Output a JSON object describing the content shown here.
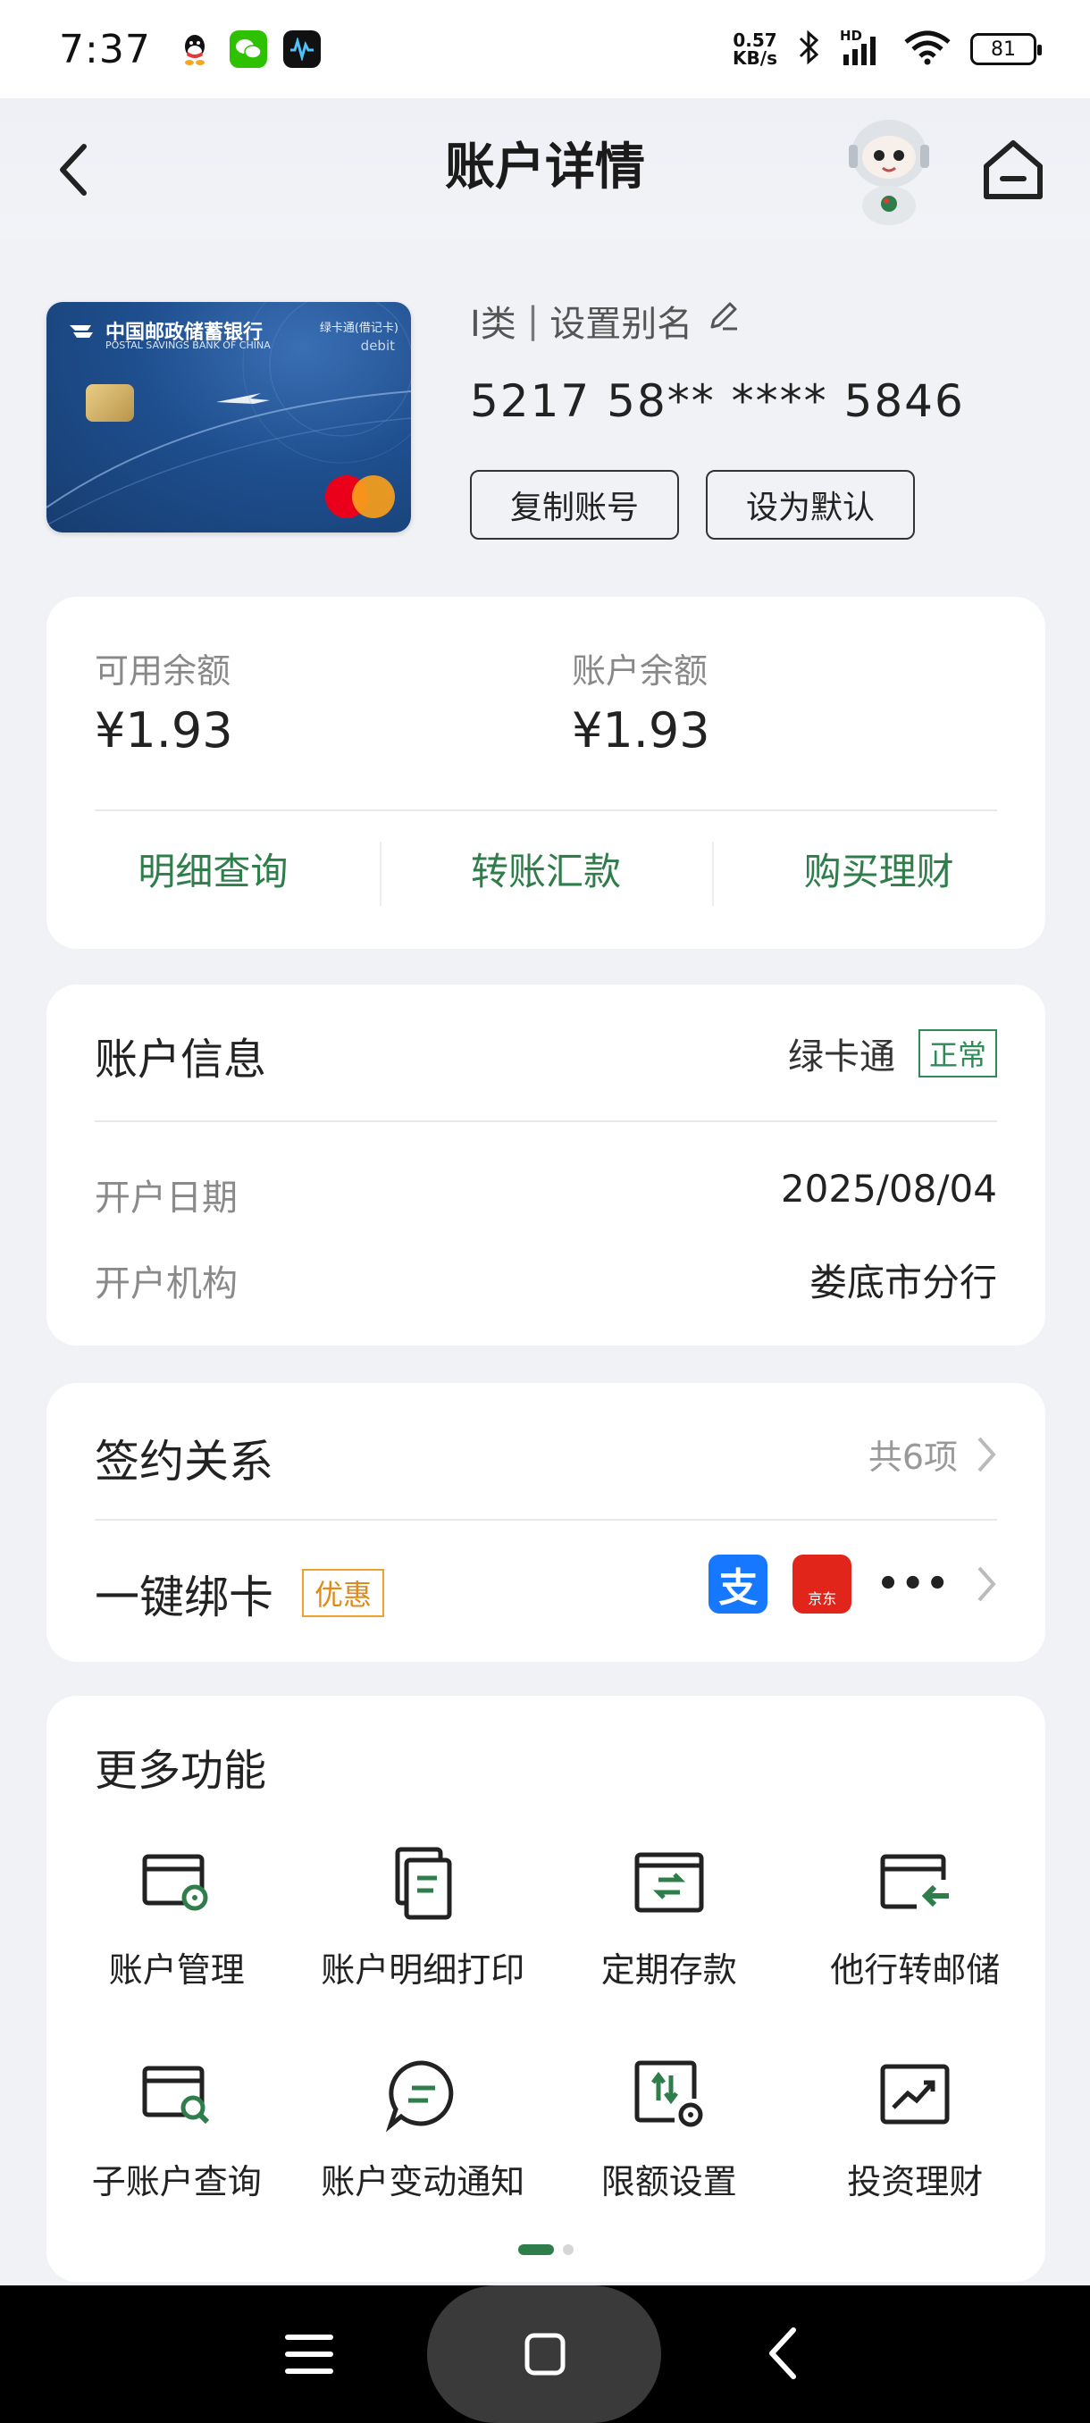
{
  "status_bar": {
    "time": "7:37",
    "net_speed_value": "0.57",
    "net_speed_unit": "KB/s",
    "signal_label": "HD",
    "battery": "81"
  },
  "header": {
    "title": "账户详情"
  },
  "card": {
    "bank_name": "中国邮政储蓄银行",
    "bank_name_en": "POSTAL SAVINGS BANK OF CHINA",
    "card_kind": "绿卡通(借记卡)",
    "card_debit": "debit",
    "account_class": "I类",
    "separator": "|",
    "alias_label": "设置别名",
    "number": "5217 58** **** 5846",
    "copy_button": "复制账号",
    "default_button": "设为默认"
  },
  "balance": {
    "available_label": "可用余额",
    "available_value": "¥1.93",
    "account_label": "账户余额",
    "account_value": "¥1.93",
    "actions": [
      "明细查询",
      "转账汇款",
      "购买理财"
    ]
  },
  "account_info": {
    "title": "账户信息",
    "product": "绿卡通",
    "status": "正常",
    "open_date_label": "开户日期",
    "open_date_value": "2025/08/04",
    "branch_label": "开户机构",
    "branch_value": "娄底市分行"
  },
  "signing": {
    "title": "签约关系",
    "count": "共6项",
    "bind_title": "一键绑卡",
    "bind_badge": "优惠",
    "alipay_glyph": "支",
    "jd_label": "京东",
    "more_glyph": "•••"
  },
  "more_functions": {
    "title": "更多功能",
    "items": [
      {
        "label": "账户管理",
        "icon": "card-gear-icon"
      },
      {
        "label": "账户明细打印",
        "icon": "document-list-icon"
      },
      {
        "label": "定期存款",
        "icon": "deposit-transfer-icon"
      },
      {
        "label": "他行转邮储",
        "icon": "card-arrow-in-icon"
      },
      {
        "label": "子账户查询",
        "icon": "card-search-icon"
      },
      {
        "label": "账户变动通知",
        "icon": "chat-bubble-icon"
      },
      {
        "label": "限额设置",
        "icon": "limit-settings-icon"
      },
      {
        "label": "投资理财",
        "icon": "trend-chart-icon"
      }
    ],
    "page_index": 1,
    "page_count": 2
  },
  "colors": {
    "accent_green": "#2e7d4a",
    "badge_orange": "#e08a1a",
    "card_blue": "#1f4f8f"
  }
}
